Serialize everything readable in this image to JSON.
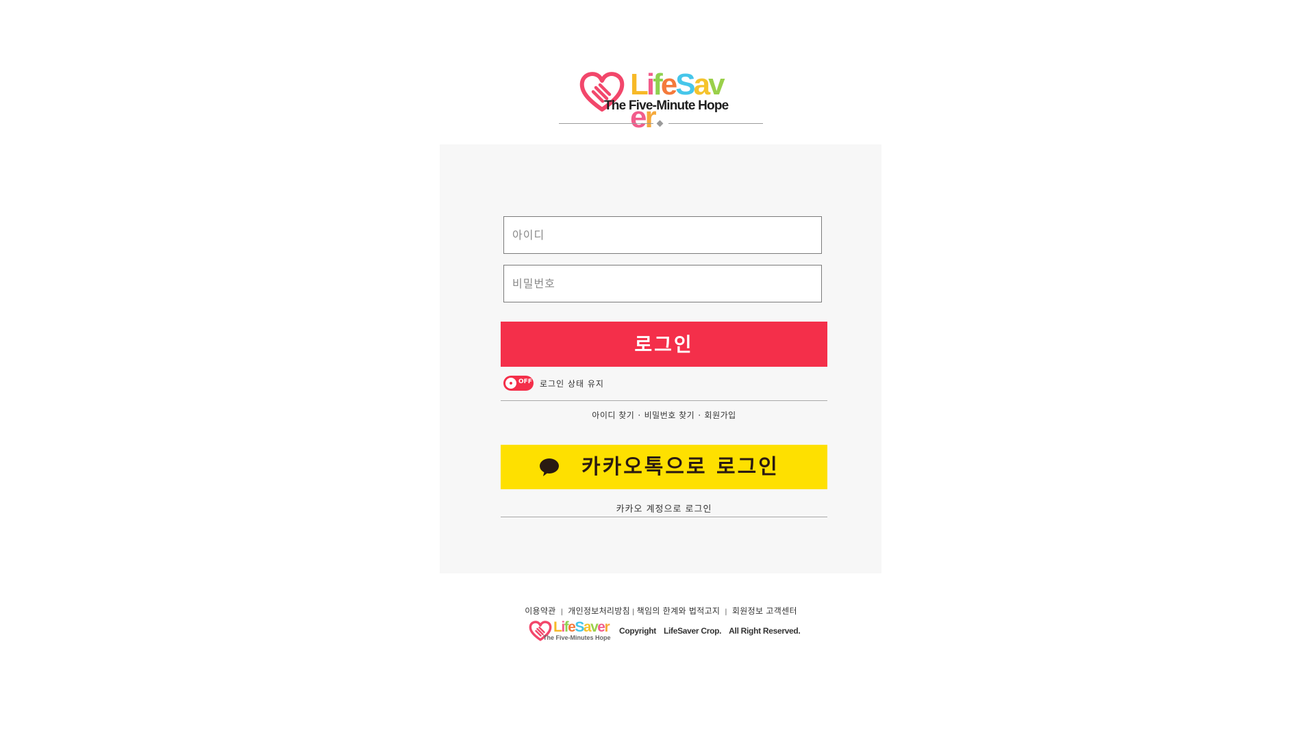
{
  "header": {
    "logo_letters": [
      {
        "ch": "L",
        "color": "#f7b927"
      },
      {
        "ch": "i",
        "color": "#f25d8c"
      },
      {
        "ch": "f",
        "color": "#8fd14f"
      },
      {
        "ch": "e",
        "color": "#f47a3c"
      },
      {
        "ch": "S",
        "color": "#46c6ea"
      },
      {
        "ch": "a",
        "color": "#f5c32d"
      },
      {
        "ch": "v",
        "color": "#9ad04a"
      },
      {
        "ch": "e",
        "color": "#f25d8c"
      },
      {
        "ch": "r",
        "color": "#f5a93c"
      }
    ],
    "tagline": "The Five-Minute Hope",
    "heart_color": "#f2476b"
  },
  "login": {
    "id_placeholder": "아이디",
    "pw_placeholder": "비밀번호",
    "login_button": "로그인",
    "keep_toggle_state": "OFF",
    "keep_label": "로그인 상태 유지",
    "links": {
      "find_id": "아이디 찾기",
      "find_pw": "비밀번호 찾기",
      "signup": "회원가입",
      "separator": "·"
    },
    "kakao_button": "카카오톡으로 로그인",
    "kakao_icon": "speech-bubble-icon",
    "kakao_sub": "카카오 계정으로 로그인",
    "accent_color": "#f42f4a",
    "kakao_color": "#fee000"
  },
  "footer": {
    "links": {
      "terms": "이용약관",
      "privacy": "개인정보처리방침",
      "disclaimer": "책임의 한계와 법적고지",
      "support": "회원정보 고객센터",
      "separator": "|"
    },
    "mini_tagline": "The Five-Minutes Hope",
    "copyright": {
      "label": "Copyright",
      "company": "LifeSaver Crop.",
      "rights": "All Right Reserved."
    }
  }
}
